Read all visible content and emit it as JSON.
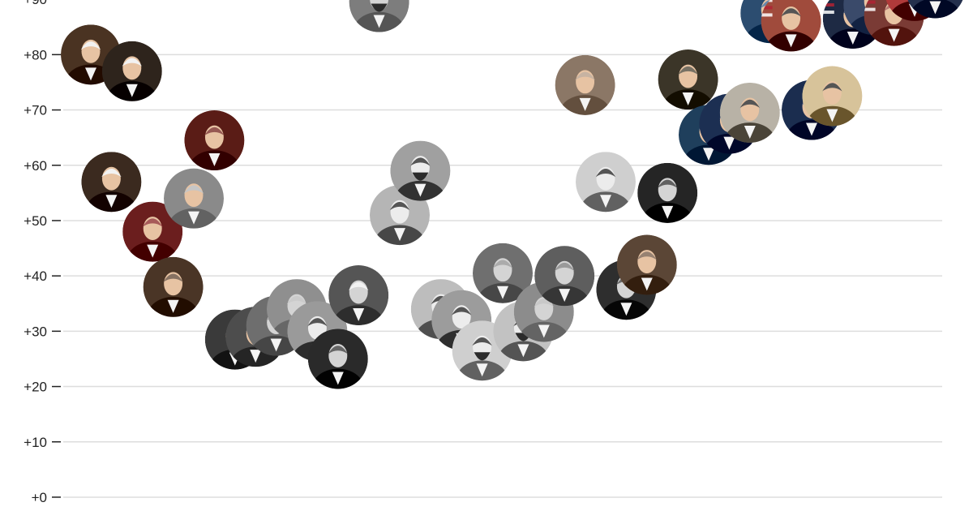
{
  "chart_data": {
    "type": "scatter",
    "title": "",
    "xlabel": "",
    "ylabel": "",
    "ylim": [
      0,
      92
    ],
    "grid": true,
    "y_ticks": [
      {
        "value": 90,
        "label": "+90"
      },
      {
        "value": 80,
        "label": "+80"
      },
      {
        "value": 70,
        "label": "+70"
      },
      {
        "value": 60,
        "label": "+60"
      },
      {
        "value": 50,
        "label": "+50"
      },
      {
        "value": 40,
        "label": "+40"
      },
      {
        "value": 30,
        "label": "+30"
      },
      {
        "value": 20,
        "label": "+20"
      },
      {
        "value": 10,
        "label": "+10"
      },
      {
        "value": 0,
        "label": "+0"
      }
    ],
    "x_axis": "chronological order of presidents (no tick labels shown)",
    "marker": "circular portrait photo",
    "series": [
      {
        "values": [
          {
            "x": 1,
            "y": 80.0,
            "portrait": "colonial-portrait-white-wig",
            "tone": "#4a3322"
          },
          {
            "x": 2,
            "y": 57.0,
            "portrait": "colonial-portrait-white-hair",
            "tone": "#3b2a1f"
          },
          {
            "x": 3,
            "y": 77.0,
            "portrait": "colonial-portrait-gray-hair",
            "tone": "#2e241c"
          },
          {
            "x": 4,
            "y": 48.0,
            "portrait": "painted-portrait-red-background",
            "tone": "#6b1e1e"
          },
          {
            "x": 5,
            "y": 38.0,
            "portrait": "painted-portrait-dark-background",
            "tone": "#4a3526"
          },
          {
            "x": 6,
            "y": 54.0,
            "portrait": "engraved-portrait-bald",
            "tone": "#8a8a8a"
          },
          {
            "x": 7,
            "y": 64.5,
            "portrait": "painted-portrait-red-cape",
            "tone": "#5a1c16"
          },
          {
            "x": 8,
            "y": 28.5,
            "portrait": "dark-photo-portrait",
            "tone": "#3a3a3a"
          },
          {
            "x": 9,
            "y": 29.0,
            "portrait": "dark-photo-portrait",
            "tone": "#4d4d4d"
          },
          {
            "x": 10,
            "y": 31.0,
            "portrait": "gray-photo-portrait",
            "tone": "#6e6e6e"
          },
          {
            "x": 11,
            "y": 34.0,
            "portrait": "gray-photo-portrait",
            "tone": "#8f8f8f"
          },
          {
            "x": 12,
            "y": 30.0,
            "portrait": "gray-photo-portrait",
            "tone": "#9a9a9a"
          },
          {
            "x": 13,
            "y": 25.0,
            "portrait": "bw-photo-portrait",
            "tone": "#2a2a2a"
          },
          {
            "x": 14,
            "y": 36.5,
            "portrait": "bw-photo-white-hair",
            "tone": "#555555"
          },
          {
            "x": 15,
            "y": 89.5,
            "portrait": "bw-photo-bearded",
            "tone": "#7d7d7d"
          },
          {
            "x": 16,
            "y": 51.0,
            "portrait": "bw-photo-portrait",
            "tone": "#b5b5b5"
          },
          {
            "x": 17,
            "y": 59.0,
            "portrait": "bw-photo-bearded",
            "tone": "#a0a0a0"
          },
          {
            "x": 18,
            "y": 34.0,
            "portrait": "gray-photo-portrait",
            "tone": "#bdbdbd"
          },
          {
            "x": 19,
            "y": 32.0,
            "portrait": "gray-photo-portrait",
            "tone": "#9c9c9c"
          },
          {
            "x": 20,
            "y": 26.5,
            "portrait": "gray-photo-bearded",
            "tone": "#cfcfcf"
          },
          {
            "x": 21,
            "y": 40.5,
            "portrait": "bw-photo-mustache",
            "tone": "#6f6f6f"
          },
          {
            "x": 22,
            "y": 30.0,
            "portrait": "gray-photo-bearded",
            "tone": "#c2c2c2"
          },
          {
            "x": 23,
            "y": 33.5,
            "portrait": "bw-photo-portrait",
            "tone": "#8c8c8c"
          },
          {
            "x": 24,
            "y": 40.0,
            "portrait": "bw-photo-mustache",
            "tone": "#5e5e5e"
          },
          {
            "x": 25,
            "y": 74.5,
            "portrait": "sepia-photo-mustache",
            "tone": "#8b7766"
          },
          {
            "x": 26,
            "y": 57.0,
            "portrait": "bw-photo-glasses",
            "tone": "#cfcfcf"
          },
          {
            "x": 27,
            "y": 37.5,
            "portrait": "bw-photo-portrait",
            "tone": "#2e2e2e"
          },
          {
            "x": 28,
            "y": 42.0,
            "portrait": "sepia-photo-portrait",
            "tone": "#5b4636"
          },
          {
            "x": 29,
            "y": 55.0,
            "portrait": "bw-photo-portrait",
            "tone": "#252525"
          },
          {
            "x": 30,
            "y": 75.5,
            "portrait": "photo-portrait-dark-suit",
            "tone": "#3b3528"
          },
          {
            "x": 31,
            "y": 65.5,
            "portrait": "photo-portrait-glasses",
            "tone": "#1f3f5c"
          },
          {
            "x": 32,
            "y": 67.5,
            "portrait": "color-photo-portrait",
            "tone": "#1c2f52"
          },
          {
            "x": 33,
            "y": 69.5,
            "portrait": "color-photo-portrait",
            "tone": "#b8b2a6"
          },
          {
            "x": 34,
            "y": 87.5,
            "portrait": "color-photo-portrait",
            "tone": "#2c4d70"
          },
          {
            "x": 35,
            "y": 86.0,
            "portrait": "color-photo-flag-background",
            "tone": "#a04b3c"
          },
          {
            "x": 36,
            "y": 70.0,
            "portrait": "color-photo-military",
            "tone": "#1b2d4f"
          },
          {
            "x": 37,
            "y": 72.5,
            "portrait": "color-photo-portrait",
            "tone": "#d7c39a"
          },
          {
            "x": 38,
            "y": 86.5,
            "portrait": "color-photo-flag-background",
            "tone": "#1e2a44"
          },
          {
            "x": 39,
            "y": 89.0,
            "portrait": "color-photo-portrait",
            "tone": "#3a4a6a"
          },
          {
            "x": 40,
            "y": 87.0,
            "portrait": "color-photo-flag-background",
            "tone": "#7a3b35"
          },
          {
            "x": 41,
            "y": 91.5,
            "portrait": "color-photo-flag-background",
            "tone": "#b03a3a"
          },
          {
            "x": 42,
            "y": 92.0,
            "portrait": "color-photo-portrait",
            "tone": "#24304d"
          }
        ]
      }
    ]
  },
  "colors": {
    "gridline": "#dddddd",
    "tick_text": "#222222",
    "tick_mark": "#222222",
    "background": "#ffffff"
  }
}
